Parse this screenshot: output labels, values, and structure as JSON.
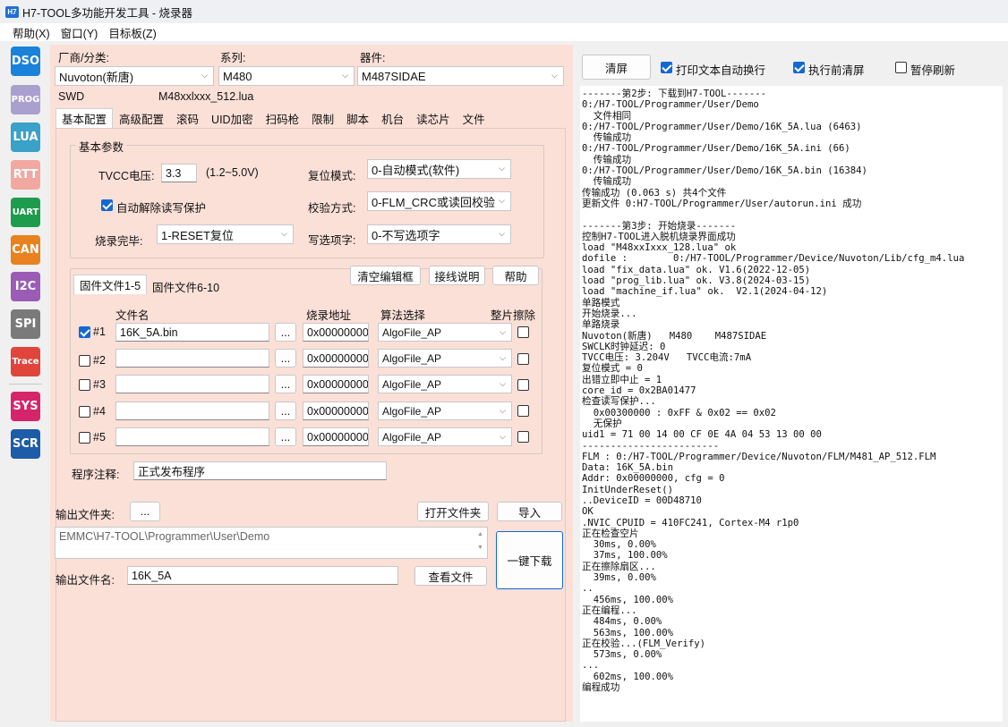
{
  "window": {
    "app_icon": "H7",
    "title": "H7-TOOL多功能开发工具 - 烧录器"
  },
  "menu": [
    "帮助(X)",
    "窗口(Y)",
    "目标板(Z)"
  ],
  "sidebar": [
    {
      "label": "DSO",
      "color": "#1a82d8"
    },
    {
      "label": "PROG",
      "color": "#a9a0ce"
    },
    {
      "label": "LUA",
      "color": "#3aa1c9"
    },
    {
      "label": "RTT",
      "color": "#f2a8a0"
    },
    {
      "label": "UART",
      "color": "#1e9c4e"
    },
    {
      "label": "CAN",
      "color": "#e8821e"
    },
    {
      "label": "I2C",
      "color": "#9a5cb4"
    },
    {
      "label": "SPI",
      "color": "#7a7a7a"
    },
    {
      "label": "Trace",
      "color": "#e0453c"
    },
    {
      "label": "SYS",
      "color": "#d6246a"
    },
    {
      "label": "SCR",
      "color": "#1c5ca8"
    }
  ],
  "selector": {
    "vendor_label": "厂商/分类:",
    "vendor_value": "Nuvoton(新唐)",
    "series_label": "系列:",
    "series_value": "M480",
    "device_label": "器件:",
    "device_value": "M487SIDAE",
    "interface": "SWD",
    "lua_file": "M48xxlxxx_512.lua"
  },
  "tabs": [
    "基本配置",
    "高级配置",
    "滚码",
    "UID加密",
    "扫码枪",
    "限制",
    "脚本",
    "机台",
    "读芯片",
    "文件"
  ],
  "basic": {
    "group_title": "基本参数",
    "tvcc_label": "TVCC电压:",
    "tvcc_value": "3.3",
    "tvcc_range": "(1.2~5.0V)",
    "reset_label": "复位模式:",
    "reset_value": "0-自动模式(软件)",
    "auto_unprotect_label": "自动解除读写保护",
    "auto_unprotect_checked": true,
    "verify_label": "校验方式:",
    "verify_value": "0-FLM_CRC或读回校验",
    "after_label": "烧录完毕:",
    "after_value": "1-RESET复位",
    "option_label": "写选项字:",
    "option_value": "0-不写选项字"
  },
  "files": {
    "tab1": "固件文件1-5",
    "tab2": "固件文件6-10",
    "clear_btn": "清空编辑框",
    "wiring_btn": "接线说明",
    "help_btn": "帮助",
    "col_name": "文件名",
    "col_addr": "烧录地址",
    "col_algo": "算法选择",
    "col_erase": "整片擦除",
    "browse": "...",
    "rows": [
      {
        "id": "#1",
        "checked": true,
        "name": "16K_5A.bin",
        "addr": "0x00000000",
        "algo": "AlgoFile_AP"
      },
      {
        "id": "#2",
        "checked": false,
        "name": "",
        "addr": "0x00000000",
        "algo": "AlgoFile_AP"
      },
      {
        "id": "#3",
        "checked": false,
        "name": "",
        "addr": "0x00000000",
        "algo": "AlgoFile_AP"
      },
      {
        "id": "#4",
        "checked": false,
        "name": "",
        "addr": "0x00000000",
        "algo": "AlgoFile_AP"
      },
      {
        "id": "#5",
        "checked": false,
        "name": "",
        "addr": "0x00000000",
        "algo": "AlgoFile_AP"
      }
    ]
  },
  "note": {
    "label": "程序注释:",
    "value": "正式发布程序"
  },
  "output": {
    "folder_label": "输出文件夹:",
    "folder_browse": "...",
    "open_folder_btn": "打开文件夹",
    "import_btn": "导入",
    "path": "EMMC\\H7-TOOL\\Programmer\\User\\Demo",
    "download_btn": "一键下载",
    "filename_label": "输出文件名:",
    "filename_value": "16K_5A",
    "view_btn": "查看文件"
  },
  "right_toolbar": {
    "clear_btn": "清屏",
    "wrap_label": "打印文本自动换行",
    "wrap_checked": true,
    "clear_before_label": "执行前清屏",
    "clear_before_checked": true,
    "pause_label": "暂停刷新",
    "pause_checked": false
  },
  "log_lines": [
    "-------第2步: 下载到H7-TOOL-------",
    "0:/H7-TOOL/Programmer/User/Demo",
    "  文件相同",
    "0:/H7-TOOL/Programmer/User/Demo/16K_5A.lua (6463)",
    "  传输成功",
    "0:/H7-TOOL/Programmer/User/Demo/16K_5A.ini (66)",
    "  传输成功",
    "0:/H7-TOOL/Programmer/User/Demo/16K_5A.bin (16384)",
    "  传输成功",
    "传输成功 (0.063 s) 共4个文件",
    "更新文件 0:H7-TOOL/Programmer/User/autorun.ini 成功",
    "",
    "-------第3步: 开始烧录-------",
    "控制H7-TOOL进入脱机烧录界面成功",
    "load \"M48xxIxxx_128.lua\" ok",
    "dofile :        0:/H7-TOOL/Programmer/Device/Nuvoton/Lib/cfg_m4.lua",
    "load \"fix_data.lua\" ok. V1.6(2022-12-05)",
    "load \"prog_lib.lua\" ok. V3.8(2024-03-15)",
    "load \"machine_if.lua\" ok.  V2.1(2024-04-12)",
    "单路模式",
    "开始烧录...",
    "单路烧录",
    "Nuvoton(新唐)   M480    M487SIDAE",
    "SWCLK时钟延迟: 0",
    "TVCC电压: 3.204V   TVCC电流:7mA",
    "复位模式 = 0",
    "出错立即中止 = 1",
    "core_id = 0x2BA01477",
    "检查读写保护...",
    "  0x00300000 : 0xFF & 0x02 == 0x02",
    "  无保护",
    "uid1 = 71 00 14 00 CF 0E 4A 04 53 13 00 00",
    "------------------------",
    "FLM : 0:/H7-TOOL/Programmer/Device/Nuvoton/FLM/M481_AP_512.FLM",
    "Data: 16K_5A.bin",
    "Addr: 0x00000000, cfg = 0",
    "InitUnderReset()",
    "..DeviceID = 00D48710",
    "OK",
    ".NVIC_CPUID = 410FC241, Cortex-M4 r1p0",
    "正在检查空片",
    "  30ms, 0.00%",
    "  37ms, 100.00%",
    "正在擦除扇区...",
    "  39ms, 0.00%",
    "..",
    "  456ms, 100.00%",
    "正在编程...",
    "  484ms, 0.00%",
    "  563ms, 100.00%",
    "正在校验...(FLM_Verify)",
    "  573ms, 0.00%",
    "...",
    "  602ms, 100.00%",
    "编程成功"
  ]
}
